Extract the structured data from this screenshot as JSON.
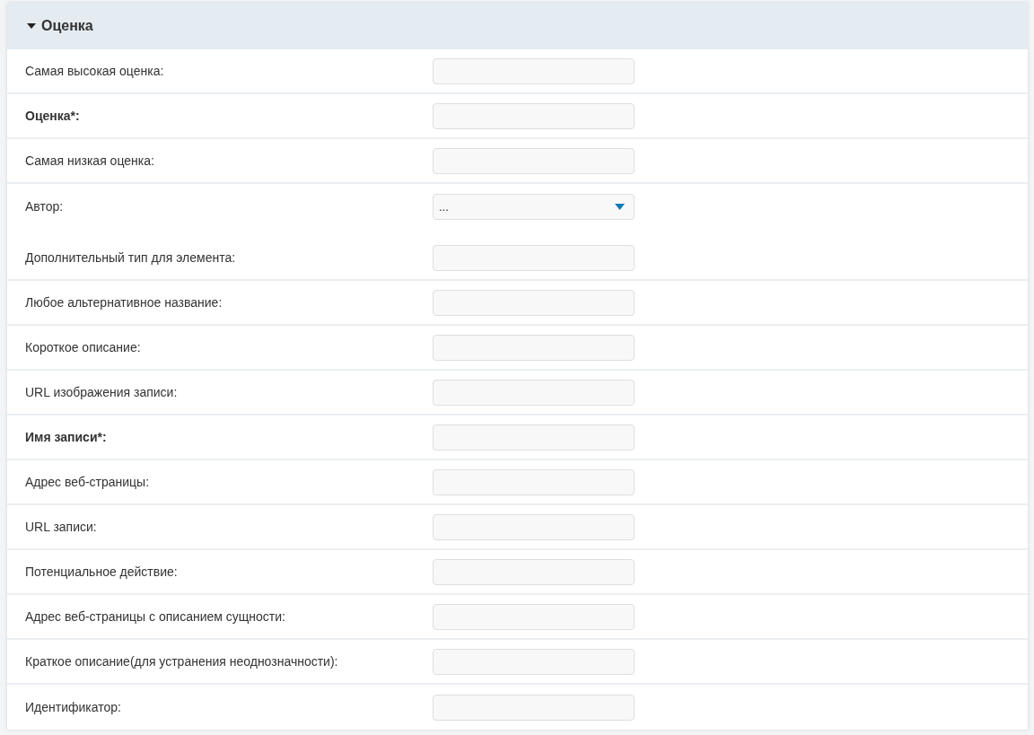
{
  "section": {
    "title": "Оценка",
    "expanded": true
  },
  "groups": [
    {
      "fields": [
        {
          "label": "Самая высокая оценка:",
          "required": false,
          "kind": "text"
        },
        {
          "label": "Оценка*:",
          "required": true,
          "kind": "text"
        },
        {
          "label": "Самая низкая оценка:",
          "required": false,
          "kind": "text"
        },
        {
          "label": "Автор:",
          "required": false,
          "kind": "select",
          "value": "..."
        }
      ]
    },
    {
      "fields": [
        {
          "label": "Дополнительный тип для элемента:",
          "required": false,
          "kind": "text"
        },
        {
          "label": "Любое альтернативное название:",
          "required": false,
          "kind": "text"
        },
        {
          "label": "Короткое описание:",
          "required": false,
          "kind": "text"
        },
        {
          "label": "URL изображения записи:",
          "required": false,
          "kind": "text"
        },
        {
          "label": "Имя записи*:",
          "required": true,
          "kind": "text"
        },
        {
          "label": "Адрес веб-страницы:",
          "required": false,
          "kind": "text"
        },
        {
          "label": "URL записи:",
          "required": false,
          "kind": "text"
        },
        {
          "label": "Потенциальное действие:",
          "required": false,
          "kind": "text"
        },
        {
          "label": "Адрес веб-страницы с описанием сущности:",
          "required": false,
          "kind": "text"
        },
        {
          "label": "Краткое описание(для устранения неоднозначности):",
          "required": false,
          "kind": "text"
        },
        {
          "label": "Идентификатор:",
          "required": false,
          "kind": "text"
        }
      ]
    }
  ]
}
